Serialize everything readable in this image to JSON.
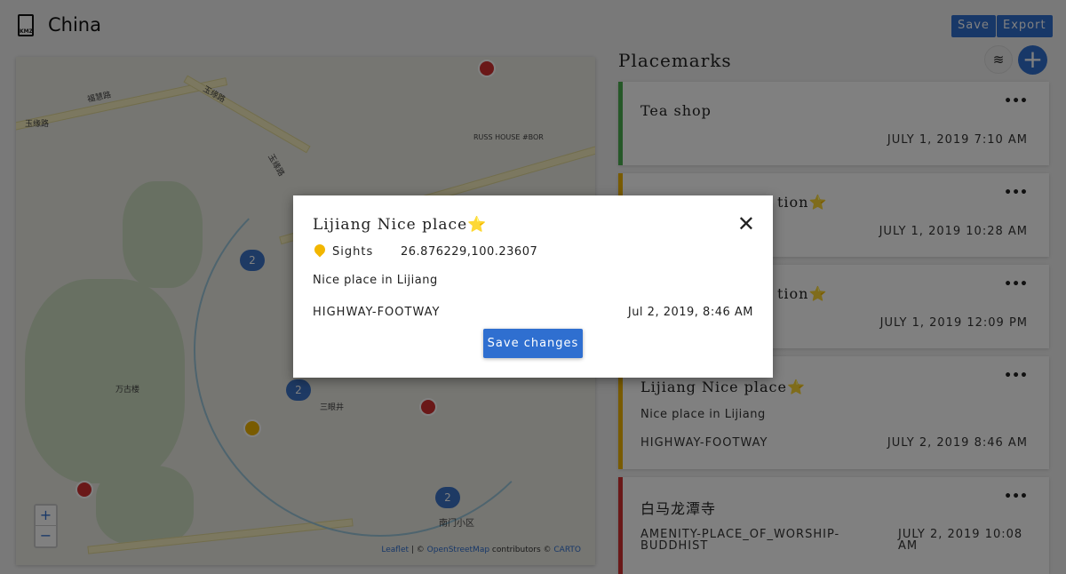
{
  "header": {
    "file_icon_text": "KMZ",
    "title": "China",
    "save_label": "Save",
    "export_label": "Export"
  },
  "map": {
    "labels": [
      "玉缘路",
      "福慧路",
      "玉缘路",
      "玉缘路",
      "RUSS HOUSE #BOR",
      "万古楼",
      "三眼井",
      "南门小区"
    ],
    "clusters": [
      "2",
      "2",
      "2"
    ],
    "zoom_in": "+",
    "zoom_out": "−",
    "attribution": {
      "leaflet": "Leaflet",
      "sep": " | © ",
      "osm": "OpenStreetMap",
      "contrib": " contributors © ",
      "carto": "CARTO"
    }
  },
  "placemarks": {
    "heading": "Placemarks",
    "add_label": "+",
    "layers_icon": "≋",
    "more": "•••",
    "cards": [
      {
        "title": "Tea shop",
        "date": "JULY 1, 2019 7:10 AM",
        "color": "#4caf50"
      },
      {
        "title": "tion⭐",
        "date": "JULY 1, 2019 10:28 AM",
        "color": "#f2b600"
      },
      {
        "title": "tion⭐",
        "date": "JULY 1, 2019 12:09 PM",
        "color": "#f2b600"
      },
      {
        "title": "Lijiang Nice place⭐",
        "desc": "Nice place in Lijiang",
        "tag": "HIGHWAY-FOOTWAY",
        "date": "JULY 2, 2019 8:46 AM",
        "color": "#f2b600"
      },
      {
        "title": "白马龙潭寺",
        "tag": "AMENITY-PLACE_OF_WORSHIP-BUDDHIST",
        "date": "JULY 2, 2019 10:08 AM",
        "color": "#d32f2f"
      }
    ]
  },
  "modal": {
    "title": "Lijiang Nice place⭐",
    "category": "Sights",
    "coords": "26.876229,100.23607",
    "description": "Nice place in Lijiang",
    "tag": "HIGHWAY-FOOTWAY",
    "date": "Jul 2, 2019, 8:46 AM",
    "save_label": "Save changes",
    "close": "✕"
  }
}
